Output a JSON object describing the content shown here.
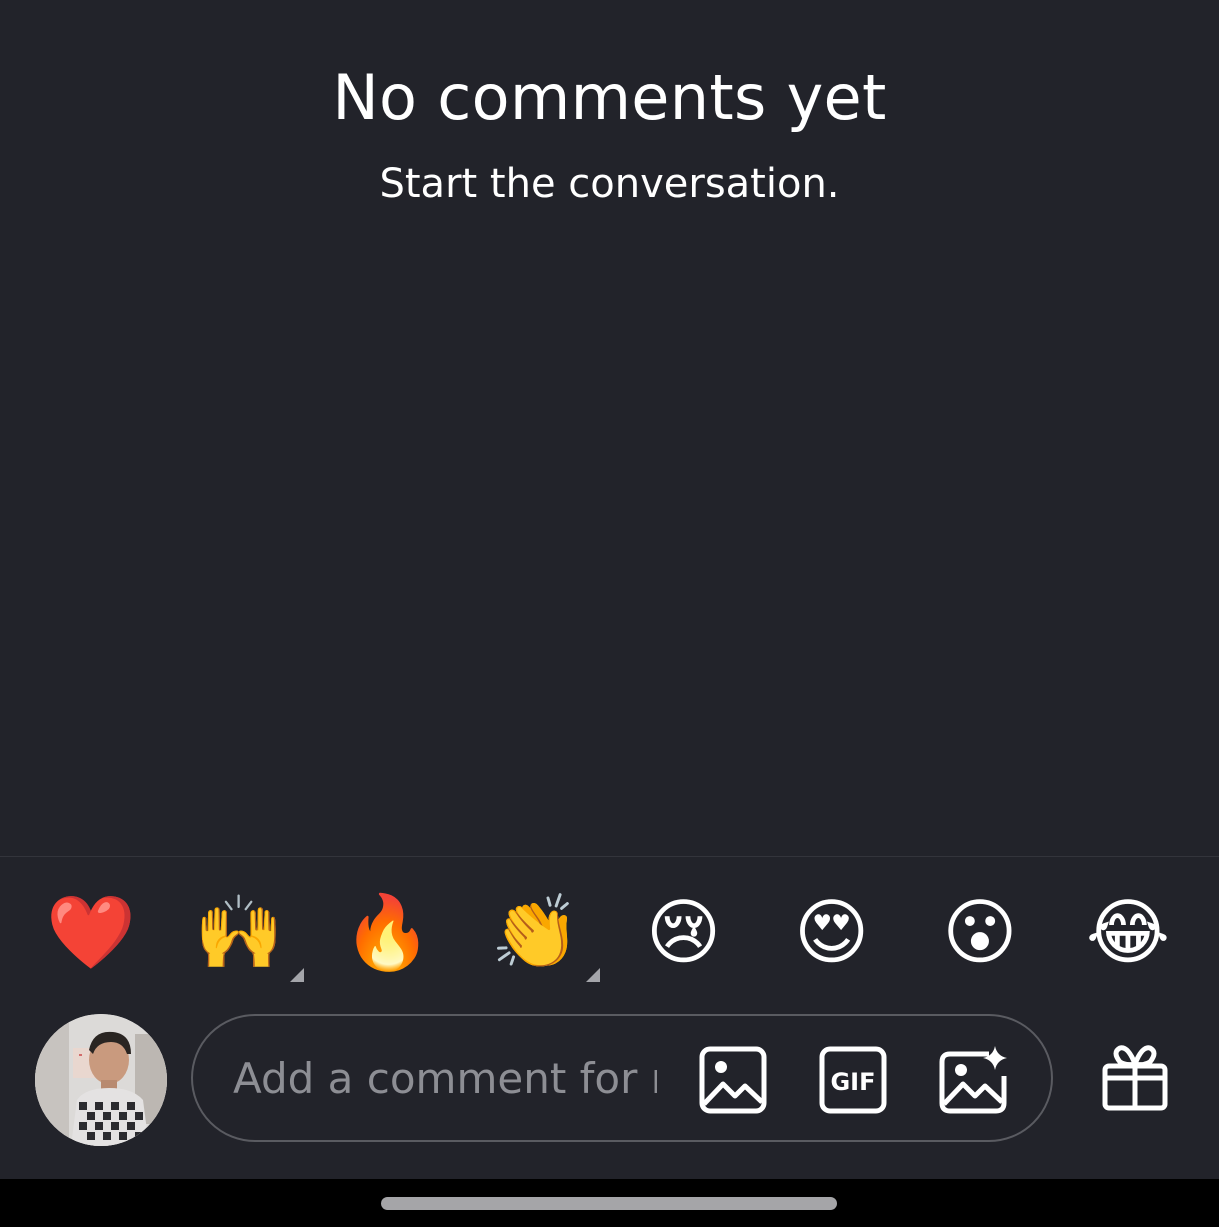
{
  "empty_state": {
    "title": "No comments yet",
    "subtitle": "Start the conversation."
  },
  "reactions": [
    {
      "name": "red-heart",
      "emoji": "❤️",
      "has_skin_tone_options": false
    },
    {
      "name": "raising-hands",
      "emoji": "🙌",
      "has_skin_tone_options": true
    },
    {
      "name": "fire",
      "emoji": "🔥",
      "has_skin_tone_options": false
    },
    {
      "name": "clapping-hands",
      "emoji": "👏",
      "has_skin_tone_options": true
    },
    {
      "name": "crying-face",
      "emoji": "😢",
      "has_skin_tone_options": false
    },
    {
      "name": "heart-eyes",
      "emoji": "😍",
      "has_skin_tone_options": false
    },
    {
      "name": "surprised-face",
      "emoji": "😮",
      "has_skin_tone_options": false
    },
    {
      "name": "tears-of-joy",
      "emoji": "😂",
      "has_skin_tone_options": false
    }
  ],
  "composer": {
    "placeholder": "Add a comment for m",
    "value": "",
    "icons": {
      "image": "image-icon",
      "gif": "gif-icon",
      "ai_image": "ai-image-icon",
      "gift": "gift-icon"
    },
    "gif_label": "GIF"
  },
  "colors": {
    "background": "#22232a",
    "text": "#ffffff",
    "placeholder": "#8d8e94",
    "border": "#5a5b61",
    "home_bar": "#000000"
  }
}
